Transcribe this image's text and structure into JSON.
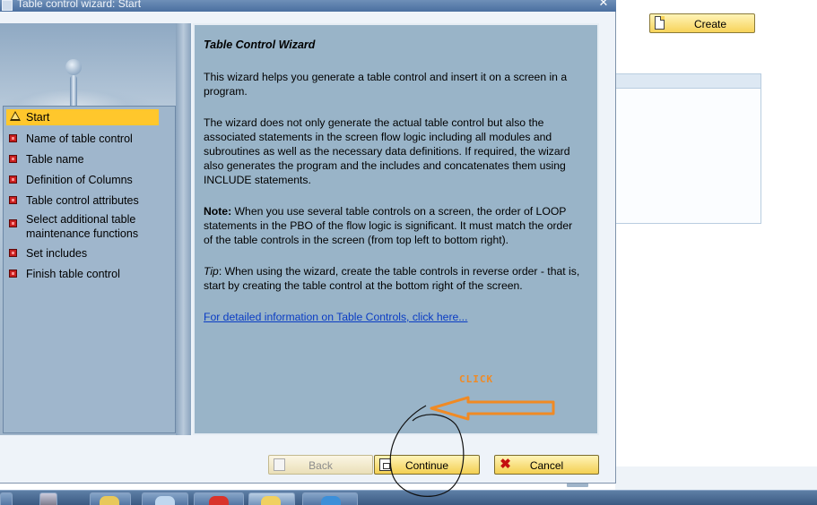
{
  "window": {
    "title": "Table control wizard: Start",
    "close_glyph": "✕"
  },
  "background_app": {
    "create_label": "Create"
  },
  "steps": [
    {
      "label": "Start",
      "state": "current",
      "icon": "warning-triangle-icon"
    },
    {
      "label": "Name of table control",
      "state": "pending",
      "icon": "red-square-icon"
    },
    {
      "label": "Table name",
      "state": "pending",
      "icon": "red-square-icon"
    },
    {
      "label": "Definition of Columns",
      "state": "pending",
      "icon": "red-square-icon"
    },
    {
      "label": "Table control attributes",
      "state": "pending",
      "icon": "red-square-icon"
    },
    {
      "label": "Select additional table maintenance functions",
      "state": "pending",
      "icon": "red-square-icon"
    },
    {
      "label": "Set includes",
      "state": "pending",
      "icon": "red-square-icon"
    },
    {
      "label": "Finish table control",
      "state": "pending",
      "icon": "red-square-icon"
    }
  ],
  "content": {
    "title": "Table Control Wizard",
    "para1": "This wizard helps you generate a table control and insert it on a screen in a program.",
    "para2": "The wizard does not only generate the actual table control but also the associated statements in the screen flow logic including all modules and subroutines as well as the necessary data definitions. If required, the wizard also generates the program and the includes and concatenates them using INCLUDE statements.",
    "note_label": "Note:",
    "note_text": " When you use several table controls on a screen, the order of LOOP statements in the PBO of the flow logic is significant. It must match the order of the table controls in the screen (from top left to bottom right).",
    "tip_label": "Tip",
    "tip_text": ": When using the wizard, create the table controls in reverse order - that is, start by creating the table control at the bottom right of the screen.",
    "link": "For detailed information on Table Controls, click here..."
  },
  "annotation": {
    "label": "CLICK",
    "color": "#f08a24"
  },
  "buttons": {
    "back": "Back",
    "continue": "Continue",
    "cancel": "Cancel"
  },
  "colors": {
    "active_step": "#ffc72c",
    "content_bg": "#99b4c8",
    "button_yellow": "#f3cf52"
  }
}
